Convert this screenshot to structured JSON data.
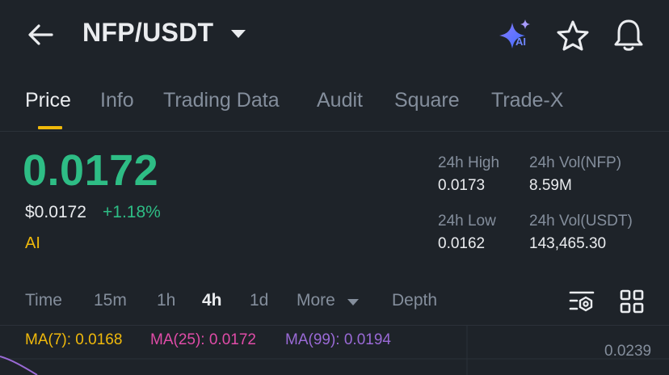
{
  "header": {
    "pair": "NFP/USDT",
    "icons": [
      "back-arrow-icon",
      "caret-down-icon",
      "ai-sparkle-icon",
      "star-icon",
      "bell-icon"
    ],
    "ai_badge": "AI"
  },
  "tabs": [
    {
      "label": "Price",
      "active": true
    },
    {
      "label": "Info"
    },
    {
      "label": "Trading Data"
    },
    {
      "label": "Audit"
    },
    {
      "label": "Square"
    },
    {
      "label": "Trade-X"
    }
  ],
  "price": {
    "last": "0.0172",
    "usd": "$0.0172",
    "change": "+1.18%",
    "ai_label": "AI"
  },
  "stats": {
    "high_label": "24h High",
    "high_value": "0.0173",
    "vol_base_label": "24h Vol(NFP)",
    "vol_base_value": "8.59M",
    "low_label": "24h Low",
    "low_value": "0.0162",
    "vol_quote_label": "24h Vol(USDT)",
    "vol_quote_value": "143,465.30"
  },
  "intervals": [
    {
      "label": "Time"
    },
    {
      "label": "15m"
    },
    {
      "label": "1h"
    },
    {
      "label": "4h",
      "active": true
    },
    {
      "label": "1d"
    },
    {
      "label": "More"
    },
    {
      "label": "Depth"
    }
  ],
  "ma": {
    "ma7": "MA(7): 0.0168",
    "ma25": "MA(25): 0.0172",
    "ma99": "MA(99): 0.0194"
  },
  "chart": {
    "axis_top": "0.0239"
  },
  "colors": {
    "background": "#1e2329",
    "up": "#2ebd85",
    "accent": "#f0b90b",
    "ma7": "#f0b90b",
    "ma25": "#e04ca8",
    "ma99": "#9a6ad6"
  }
}
